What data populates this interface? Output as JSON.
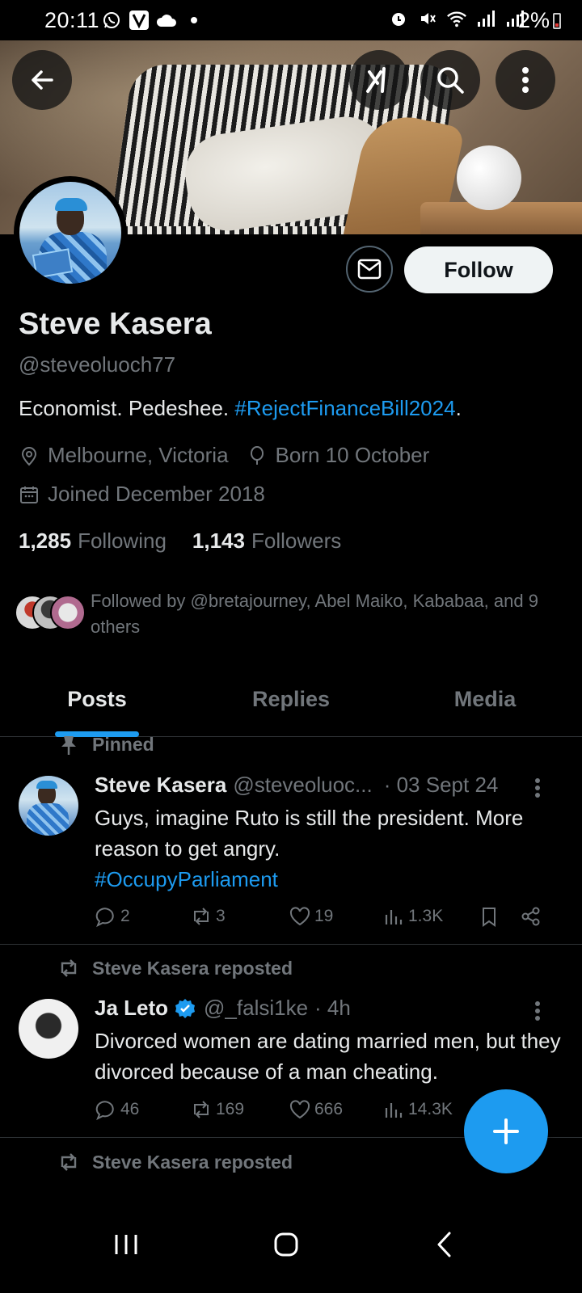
{
  "status_bar": {
    "time": "20:11",
    "battery": "2%",
    "left_icons": [
      "whatsapp-icon",
      "v-app-icon",
      "cloud-icon",
      "dot-icon"
    ],
    "right_icons": [
      "alarm-icon",
      "mute-icon",
      "wifi-icon",
      "signal-icon",
      "signal-icon"
    ]
  },
  "header": {
    "back": "back-arrow-icon",
    "grok": "grok-icon",
    "search": "search-icon",
    "more": "more-vertical-icon"
  },
  "profile": {
    "name": "Steve Kasera",
    "handle": "@steveoluoch77",
    "bio_text": "Economist. Pedeshee. ",
    "bio_hashtag": "#RejectFinanceBill2024",
    "bio_end": ".",
    "location": "Melbourne, Victoria",
    "birthday": "Born 10 October",
    "joined": "Joined December 2018",
    "following_count": "1,285",
    "following_label": "Following",
    "followers_count": "1,143",
    "followers_label": "Followers",
    "followed_by": "Followed by @bretajourney, Abel Maiko, Kababaa, and 9 others",
    "follow_button": "Follow"
  },
  "tabs": [
    {
      "label": "Posts",
      "active": true
    },
    {
      "label": "Replies",
      "active": false
    },
    {
      "label": "Media",
      "active": false
    }
  ],
  "posts": [
    {
      "context": "Pinned",
      "author": "Steve Kasera",
      "handle": "@steveoluoc...",
      "time": "· 03 Sept 24",
      "text": "Guys, imagine Ruto is still the president. More reason to get angry.",
      "hashtag": "#OccupyParliament",
      "replies": "2",
      "reposts": "3",
      "likes": "19",
      "views": "1.3K"
    },
    {
      "context": "Steve Kasera reposted",
      "author": "Ja Leto",
      "handle": "@_falsi1ke",
      "time": "· 4h",
      "text": "Divorced women are dating married men, but they divorced because of a man cheating.",
      "replies": "46",
      "reposts": "169",
      "likes": "666",
      "views": "14.3K"
    },
    {
      "context": "Steve Kasera reposted"
    }
  ],
  "colors": {
    "accent": "#1d9bf0",
    "muted": "#71767b",
    "text": "#e7e9ea",
    "background": "#000000"
  }
}
